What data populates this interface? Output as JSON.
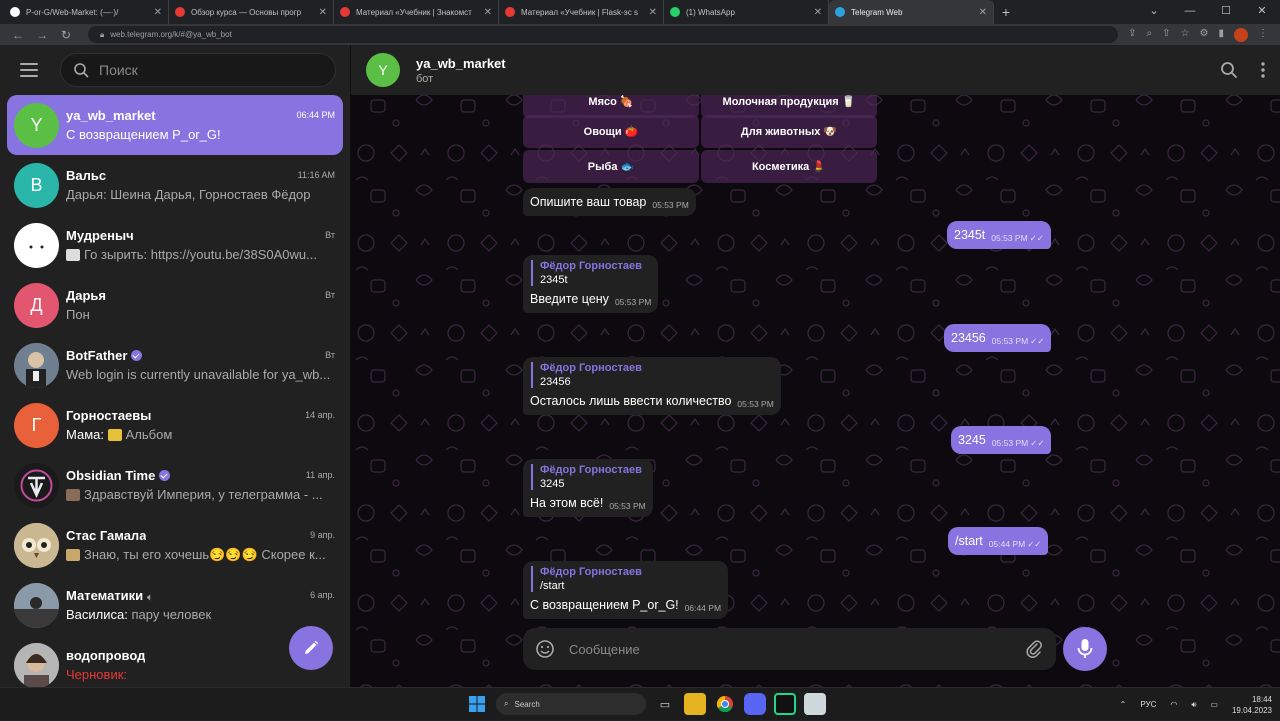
{
  "browser": {
    "tabs": [
      {
        "title": "P-or-G/Web-Market: (—·)/",
        "favicon_color": "#ffffff"
      },
      {
        "title": "Обзор курса — Основы прогр",
        "favicon_color": "#e53935"
      },
      {
        "title": "Материал «Учебник | Знакомст",
        "favicon_color": "#e53935"
      },
      {
        "title": "Материал «Учебник | Flask-эс s",
        "favicon_color": "#e53935"
      },
      {
        "title": "(1) WhatsApp",
        "favicon_color": "#25d366"
      },
      {
        "title": "Telegram Web",
        "favicon_color": "#2aa3e0",
        "active": true
      }
    ],
    "url": "web.telegram.org/k/#@ya_wb_bot"
  },
  "sidebar": {
    "search_placeholder": "Поиск",
    "chats": [
      {
        "name": "ya_wb_market",
        "time": "06:44 PM",
        "preview": "С возвращением P_or_G!",
        "avatar_letter": "Y",
        "avatar_color": "#5bbf46",
        "active": true
      },
      {
        "name": "Вальс",
        "time": "11:16 AM",
        "preview": "Дарья: Шеина Дарья, Горностаев Фёдор",
        "avatar_letter": "В",
        "avatar_color": "#2ab7a9"
      },
      {
        "name": "Мудреныч",
        "time": "Вт",
        "preview": "Го зырить: https://youtu.be/38S0A0wu...",
        "avatar_letter": "",
        "avatar_color": "#ffffff"
      },
      {
        "name": "Дарья",
        "time": "Вт",
        "preview": "Пон",
        "avatar_letter": "Д",
        "avatar_color": "#e2566f"
      },
      {
        "name": "BotFather",
        "time": "Вт",
        "preview": "Web login is currently unavailable for ya_wb...",
        "avatar_letter": "",
        "avatar_color": "#3b4a5c",
        "verified": true
      },
      {
        "name": "Горностаевы",
        "time": "14 апр.",
        "preview_sender": "Мама:",
        "preview": "Альбом",
        "avatar_letter": "Г",
        "avatar_color": "#e8613b"
      },
      {
        "name": "Obsidian Time",
        "time": "11 апр.",
        "preview": "Здравствуй Империя, у телеграмма - ...",
        "avatar_letter": "",
        "avatar_color": "#1a1a1a",
        "verified": true
      },
      {
        "name": "Стас Гамала",
        "time": "9 апр.",
        "preview": "Знаю, ты его хочешь😏😏😏 Скорее к...",
        "avatar_letter": "",
        "avatar_color": "#d8c9a8"
      },
      {
        "name": "Математики",
        "time": "6 апр.",
        "preview_sender": "Василиса:",
        "preview": "пару человек",
        "avatar_letter": "",
        "avatar_color": "#4a4a4a",
        "muted": true
      },
      {
        "name": "водопровод",
        "time": "",
        "preview_draft": "Черновик:",
        "preview": "",
        "avatar_letter": "",
        "avatar_color": "#8d8d8d"
      }
    ]
  },
  "chat": {
    "title": "ya_wb_market",
    "status": "бот",
    "avatar_letter": "Y",
    "keyboard": [
      [
        "Мясо 🍖",
        "Молочная продукция 🥛"
      ],
      [
        "Овощи 🍅",
        "Для животных 🐶"
      ],
      [
        "Рыба 🐟",
        "Косметика 💄"
      ]
    ],
    "messages": [
      {
        "dir": "in",
        "text": "Опишите ваш товар",
        "time": "05:53 PM"
      },
      {
        "dir": "out",
        "text": "2345t",
        "time": "05:53 PM"
      },
      {
        "dir": "in",
        "reply_name": "Фёдор Горностаев",
        "reply_text": "2345t",
        "text": "Введите цену",
        "time": "05:53 PM"
      },
      {
        "dir": "out",
        "text": "23456",
        "time": "05:53 PM"
      },
      {
        "dir": "in",
        "reply_name": "Фёдор Горностаев",
        "reply_text": "23456",
        "text": "Осталось лишь ввести количество",
        "time": "05:53 PM"
      },
      {
        "dir": "out",
        "text": "3245",
        "time": "05:53 PM"
      },
      {
        "dir": "in",
        "reply_name": "Фёдор Горностаев",
        "reply_text": "3245",
        "text": "На этом всё!",
        "time": "05:53 PM"
      },
      {
        "dir": "out",
        "text": "/start",
        "time": "05:44 PM"
      },
      {
        "dir": "in",
        "reply_name": "Фёдор Горностаев",
        "reply_text": "/start",
        "text": "С возвращением P_or_G!",
        "time": "06:44 PM"
      }
    ],
    "composer_placeholder": "Сообщение"
  },
  "taskbar": {
    "search_label": "Search",
    "lang": "РУС",
    "time": "18:44",
    "date": "19.04.2023"
  },
  "colors": {
    "accent": "#8774e1",
    "sidebar_bg": "#212121",
    "chat_bg": "#0d0a0f"
  }
}
